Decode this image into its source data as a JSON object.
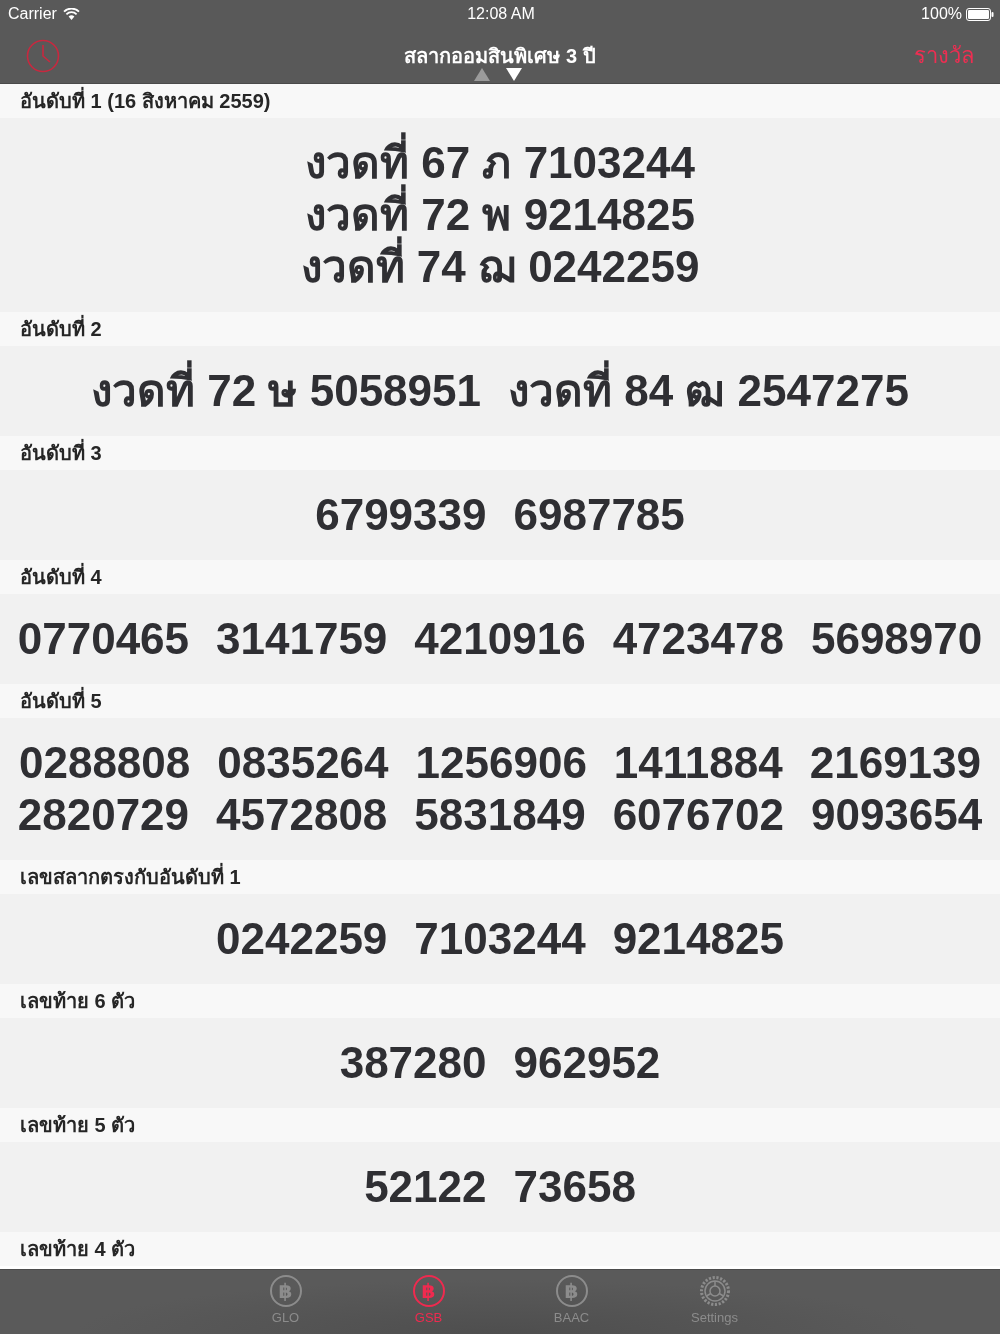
{
  "status_bar": {
    "carrier": "Carrier",
    "time": "12:08 AM",
    "battery": "100%"
  },
  "nav_bar": {
    "title": "สลากออมสินพิเศษ 3 ปี",
    "right_button": "รางวัล",
    "arrows": [
      {
        "kind": "up",
        "disabled": true
      },
      {
        "kind": "down",
        "disabled": false
      }
    ]
  },
  "sections": [
    {
      "title": "อันดับที่ 1 (16 สิงหาคม 2559)",
      "lines": [
        [
          "งวดที่ 67 ภ 7103244"
        ],
        [
          "งวดที่ 72 พ 9214825"
        ],
        [
          "งวดที่ 74 ฌ 0242259"
        ]
      ]
    },
    {
      "title": "อันดับที่ 2",
      "lines": [
        [
          "งวดที่ 72 ษ 5058951",
          "งวดที่ 84 ฒ 2547275"
        ]
      ]
    },
    {
      "title": "อันดับที่ 3",
      "lines": [
        [
          "6799339",
          "6987785"
        ]
      ]
    },
    {
      "title": "อันดับที่ 4",
      "lines": [
        [
          "0770465",
          "3141759",
          "4210916",
          "4723478",
          "5698970"
        ]
      ]
    },
    {
      "title": "อันดับที่ 5",
      "lines": [
        [
          "0288808",
          "0835264",
          "1256906",
          "1411884",
          "2169139"
        ],
        [
          "2820729",
          "4572808",
          "5831849",
          "6076702",
          "9093654"
        ]
      ]
    },
    {
      "title": "เลขสลากตรงกับอันดับที่ 1",
      "lines": [
        [
          "0242259",
          "7103244",
          "9214825"
        ]
      ]
    },
    {
      "title": "เลขท้าย 6 ตัว",
      "lines": [
        [
          "387280",
          "962952"
        ]
      ]
    },
    {
      "title": "เลขท้าย 5 ตัว",
      "lines": [
        [
          "52122",
          "73658"
        ]
      ]
    },
    {
      "title": "เลขท้าย 4 ตัว"
    }
  ],
  "tab_bar": {
    "tabs": [
      {
        "kind": "coin",
        "icon": "฿",
        "label": "GLO",
        "selected": false
      },
      {
        "kind": "coin",
        "icon": "฿",
        "label": "GSB",
        "selected": true
      },
      {
        "kind": "coin",
        "icon": "฿",
        "label": "BAAC",
        "selected": false
      },
      {
        "kind": "gear",
        "label": "Settings",
        "selected": false
      }
    ]
  }
}
